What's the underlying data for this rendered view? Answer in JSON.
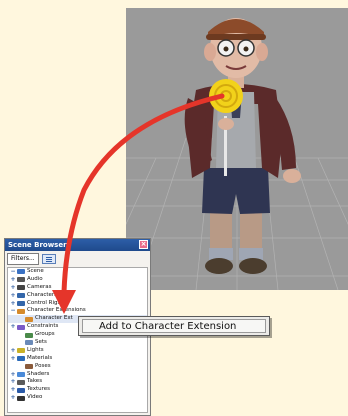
{
  "viewport": {
    "background": "#9a9a9a",
    "grid_color": "#b5b5b5"
  },
  "scene_browser": {
    "title": "Scene Browser",
    "close_symbol": "×",
    "filters_label": "Filters...",
    "items": [
      {
        "label": "Scene",
        "toggle": "−",
        "icon": "#3a72c4"
      },
      {
        "label": "Audio",
        "toggle": "+",
        "icon": "#555555"
      },
      {
        "label": "Cameras",
        "toggle": "+",
        "icon": "#444444"
      },
      {
        "label": "Characters",
        "toggle": "+",
        "icon": "#3366aa"
      },
      {
        "label": "Control Rigs",
        "toggle": "+",
        "icon": "#3366aa"
      },
      {
        "label": "Character Extensions",
        "toggle": "−",
        "icon": "#d68a2a"
      },
      {
        "label": "Character Ext",
        "toggle": "",
        "icon": "#d68a2a"
      },
      {
        "label": "Constraints",
        "toggle": "+",
        "icon": "#7a5ac8"
      },
      {
        "label": "Groups",
        "toggle": "",
        "icon": "#4a8a4a"
      },
      {
        "label": "Sets",
        "toggle": "",
        "icon": "#6a8ab8"
      },
      {
        "label": "Lights",
        "toggle": "+",
        "icon": "#c9b227"
      },
      {
        "label": "Materials",
        "toggle": "+",
        "icon": "#2a6ab8"
      },
      {
        "label": "Poses",
        "toggle": "",
        "icon": "#8a5a3a"
      },
      {
        "label": "Shaders",
        "toggle": "+",
        "icon": "#4a8ad8"
      },
      {
        "label": "Takes",
        "toggle": "+",
        "icon": "#5a5a5a"
      },
      {
        "label": "Textures",
        "toggle": "+",
        "icon": "#2a5aa8"
      },
      {
        "label": "Video",
        "toggle": "+",
        "icon": "#333333"
      }
    ]
  },
  "context_menu": {
    "item_label": "Add to Character Extension"
  },
  "arrow_color": "#e5352a"
}
